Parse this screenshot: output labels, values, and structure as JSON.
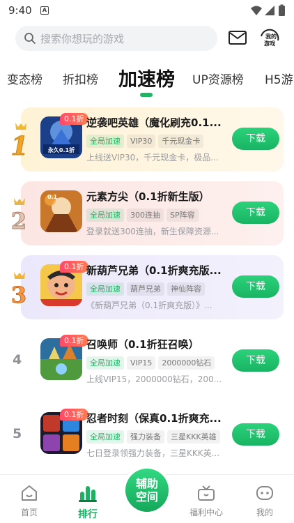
{
  "status_bar": {
    "time": "9:40",
    "notification_letter": "A"
  },
  "search": {
    "placeholder": "搜索你想玩的游戏"
  },
  "header": {
    "my_games_label": "我的游戏"
  },
  "tabs": [
    {
      "label": "变态榜",
      "active": false
    },
    {
      "label": "折扣榜",
      "active": false
    },
    {
      "label": "加速榜",
      "active": true
    },
    {
      "label": "UP资源榜",
      "active": false
    },
    {
      "label": "H5游",
      "active": false
    }
  ],
  "games": [
    {
      "rank": "1",
      "badge": "0.1折",
      "title": "逆袭吧英雄（魔化刷充0.1...",
      "tags": [
        "全局加速",
        "VIP30",
        "千元现金卡"
      ],
      "desc": "上线送VIP30，千元现金卡，极品...",
      "button": "下载"
    },
    {
      "rank": "2",
      "badge": "",
      "title": "元素方尖（0.1折新生版）",
      "tags": [
        "全局加速",
        "300连抽",
        "SP阵容"
      ],
      "desc": "登录就送300连抽，新生保障资源...",
      "button": "下载"
    },
    {
      "rank": "3",
      "badge": "0.1折",
      "title": "新葫芦兄弟（0.1折爽充版...",
      "tags": [
        "全局加速",
        "葫芦兄弟",
        "神仙阵容"
      ],
      "desc": "《新葫芦兄弟（0.1折爽充版）》...",
      "button": "下载"
    },
    {
      "rank": "4",
      "badge": "0.1折",
      "title": "召唤师（0.1折狂召唤）",
      "tags": [
        "全局加速",
        "VIP15",
        "2000000钻石"
      ],
      "desc": "上线VIP15，2000000钻石，200...",
      "button": "下载"
    },
    {
      "rank": "5",
      "badge": "0.1折",
      "title": "忍者时刻（保真0.1折爽充...",
      "tags": [
        "全局加速",
        "强力装备",
        "三星KKK英雄"
      ],
      "desc": "七日登录领强力装备，三星KKK英...",
      "button": "下载"
    }
  ],
  "thumb_texts": {
    "g1_text": "永久0.1折",
    "g2_text": "0.1"
  },
  "bottom_nav": [
    {
      "label": "首页",
      "icon": "home-icon"
    },
    {
      "label": "排行",
      "icon": "ranking-icon"
    },
    {
      "label": "福利中心",
      "icon": "gift-icon"
    },
    {
      "label": "我的",
      "icon": "profile-icon"
    }
  ],
  "assist_button": {
    "line1": "辅助",
    "line2": "空间"
  },
  "colors": {
    "accent": "#1db665",
    "badge": "#ff4a6a",
    "card1": "#fff6df",
    "card2": "#fdecea",
    "card3": "#efecfb"
  }
}
